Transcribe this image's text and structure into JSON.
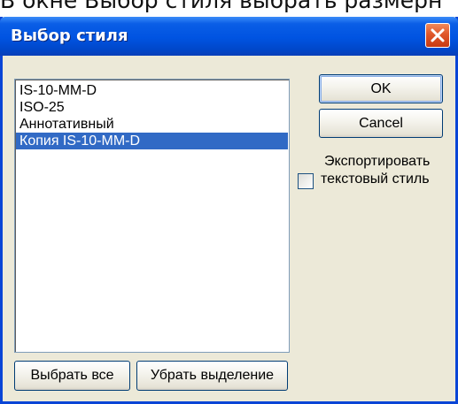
{
  "page_caption": "В окне Выбор стиля выбрать размерн",
  "dialog": {
    "title": "Выбор стиля",
    "close_icon": "close-icon",
    "styles_list": {
      "items": [
        {
          "label": "IS-10-MM-D",
          "selected": false
        },
        {
          "label": "ISO-25",
          "selected": false
        },
        {
          "label": "Аннотативный",
          "selected": false
        },
        {
          "label": "Копия IS-10-MM-D",
          "selected": true
        }
      ],
      "selection_color": "#316ac5"
    },
    "ok_label": "OK",
    "cancel_label": "Cancel",
    "export_checkbox": {
      "label_line1": "Экспортировать",
      "label_line2": "текстовый стиль",
      "checked": false
    },
    "select_all_label": "Выбрать все",
    "deselect_label": "Убрать выделение"
  },
  "colors": {
    "titlebar": "#0053e1",
    "window_bg": "#ece9d8",
    "close_button": "#e0572a"
  }
}
